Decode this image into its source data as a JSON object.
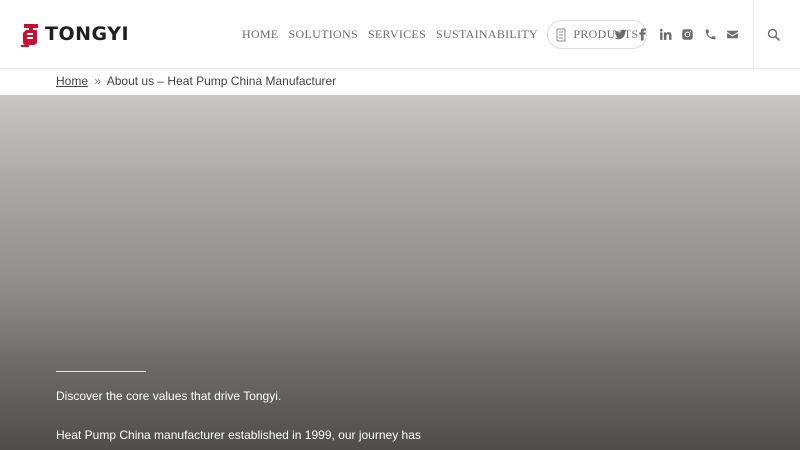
{
  "brand": {
    "name": "TONGYI",
    "color": "#c8102e"
  },
  "nav": {
    "items": [
      "HOME",
      "SOLUTIONS",
      "SERVICES",
      "SUSTAINABILITY"
    ],
    "products_label": "PRODUCTS"
  },
  "social": [
    "twitter-icon",
    "facebook-icon",
    "linkedin-icon",
    "instagram-icon",
    "phone-icon",
    "envelope-icon"
  ],
  "breadcrumb": {
    "home": "Home",
    "separator": "»",
    "current": "About us – Heat Pump China Manufacturer"
  },
  "hero": {
    "subtitle": "Discover the core values that drive Tongyi.",
    "body": "Heat Pump China manufacturer established in 1999, our journey has"
  },
  "colors": {
    "nav_text": "#6d6d6d",
    "hero_text": "#ffffff"
  }
}
